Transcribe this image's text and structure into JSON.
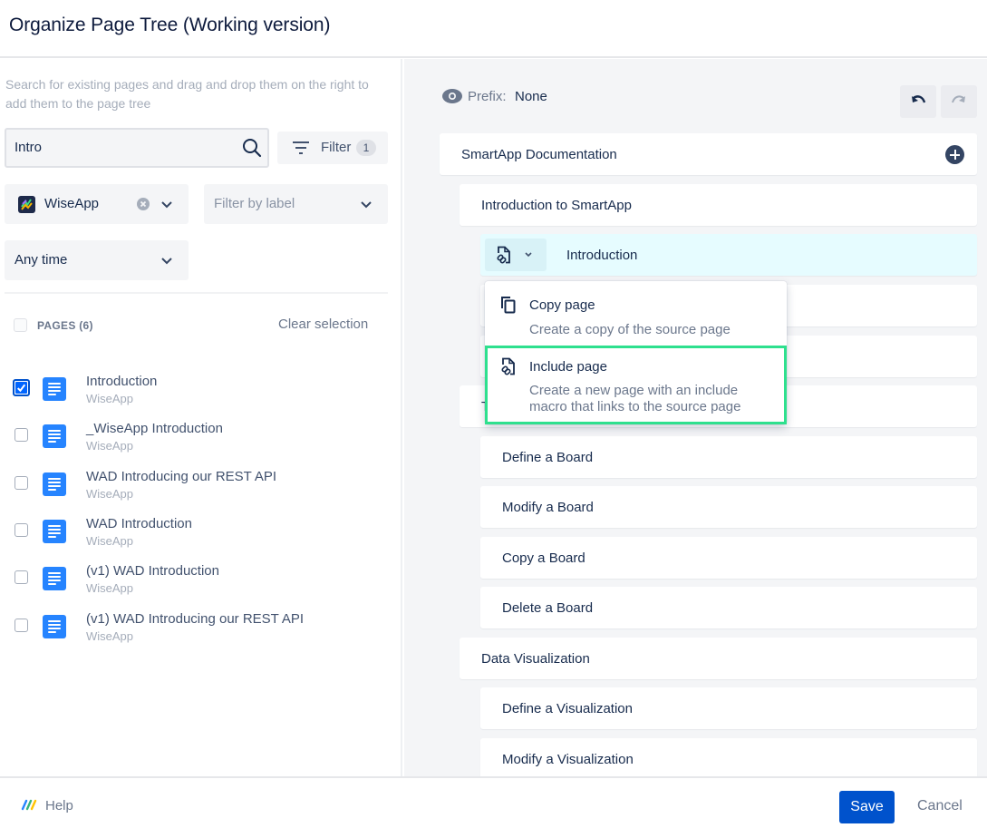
{
  "header": {
    "title": "Organize Page Tree (Working version)"
  },
  "left": {
    "hint": "Search for existing pages and drag and drop them on the right to add them to the page tree",
    "search": {
      "value": "Intro",
      "icon": "search-icon"
    },
    "filter": {
      "label": "Filter",
      "count": "1",
      "icon": "filter-icon"
    },
    "space_select": {
      "value": "WiseApp"
    },
    "label_select": {
      "placeholder": "Filter by label"
    },
    "time_select": {
      "value": "Any time"
    },
    "pages_header": {
      "label": "PAGES (6)",
      "clear": "Clear selection"
    },
    "pages": [
      {
        "title": "Introduction",
        "space": "WiseApp",
        "checked": true
      },
      {
        "title": "_WiseApp Introduction",
        "space": "WiseApp",
        "checked": false
      },
      {
        "title": "WAD Introducing our REST API",
        "space": "WiseApp",
        "checked": false
      },
      {
        "title": "WAD Introduction",
        "space": "WiseApp",
        "checked": false
      },
      {
        "title": "(v1) WAD Introduction",
        "space": "WiseApp",
        "checked": false
      },
      {
        "title": "(v1) WAD Introducing our REST API",
        "space": "WiseApp",
        "checked": false
      }
    ]
  },
  "right": {
    "prefix_label": "Prefix:",
    "prefix_value": "None",
    "tree": [
      {
        "label": "SmartApp Documentation",
        "level": 0
      },
      {
        "label": "Introduction to SmartApp",
        "level": 1
      },
      {
        "label": "Introduction",
        "level": 2,
        "selected": true
      },
      {
        "label": "",
        "level": 2
      },
      {
        "label": "",
        "level": 2
      },
      {
        "label": "T",
        "level": 1
      },
      {
        "label": "Define a Board",
        "level": 2
      },
      {
        "label": "Modify a Board",
        "level": 2
      },
      {
        "label": "Copy a Board",
        "level": 2
      },
      {
        "label": "Delete a Board",
        "level": 2
      },
      {
        "label": "Data Visualization",
        "level": 1
      },
      {
        "label": "Define a Visualization",
        "level": 2
      },
      {
        "label": "Modify a Visualization",
        "level": 2
      }
    ],
    "menu": {
      "copy": {
        "title": "Copy page",
        "desc": "Create a copy of the source page"
      },
      "include": {
        "title": "Include page",
        "desc_line1": "Create a new page with an include",
        "desc_line2": "macro that links to the source page"
      }
    }
  },
  "footer": {
    "help": "Help",
    "save": "Save",
    "cancel": "Cancel"
  },
  "colors": {
    "primary": "#0052cc",
    "highlight": "#2ee08e",
    "selected_row": "#e6fcff",
    "doc_icon": "#2684ff"
  }
}
